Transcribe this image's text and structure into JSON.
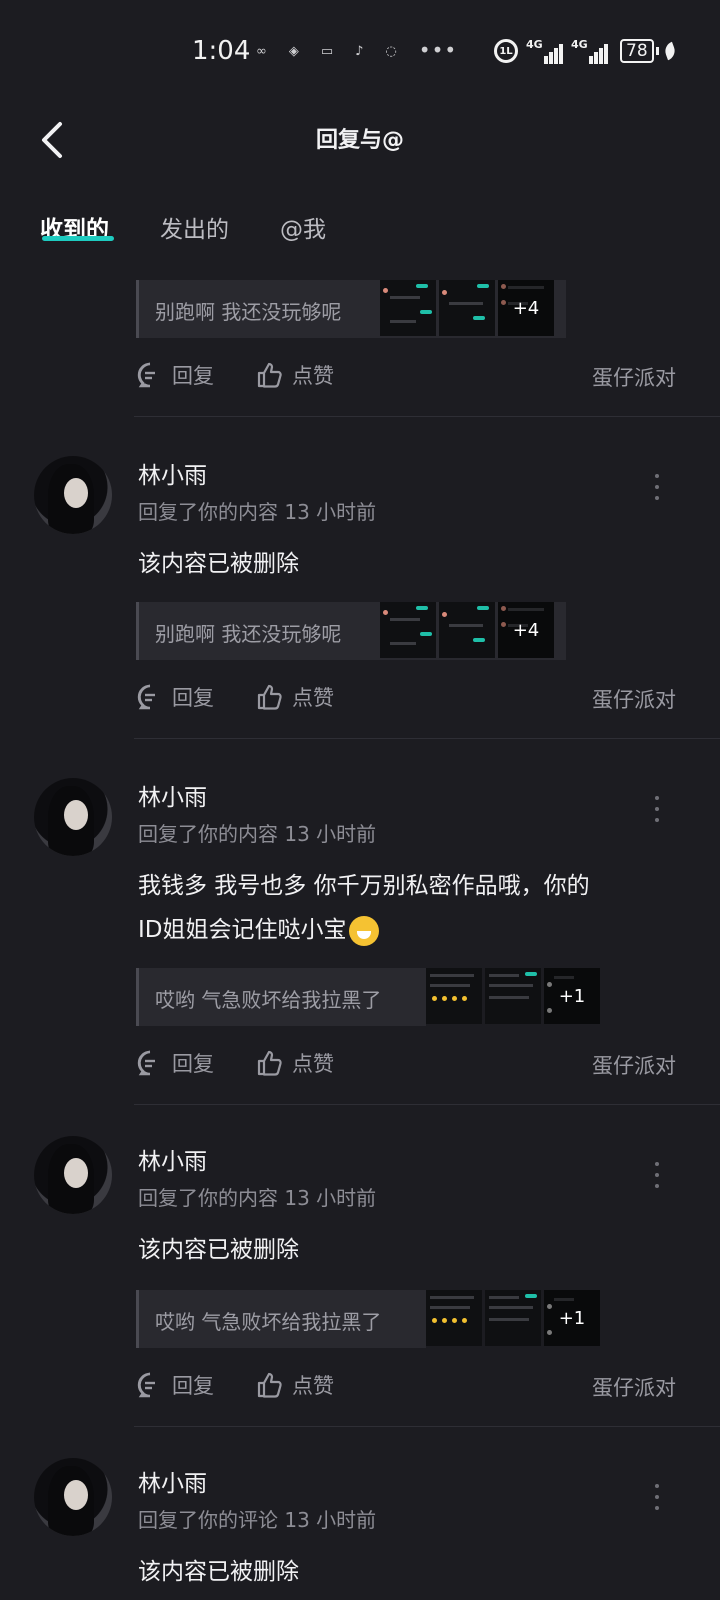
{
  "status_bar": {
    "time": "1:04",
    "hd_label": "1L",
    "network_1": "4G",
    "network_2": "4G",
    "battery": "78",
    "more": "•••"
  },
  "nav": {
    "title": "回复与@"
  },
  "tabs": [
    {
      "label": "收到的",
      "active": true
    },
    {
      "label": "发出的",
      "active": false
    },
    {
      "label": "@我",
      "active": false
    }
  ],
  "accent_color": "#1ecbc0",
  "actions": {
    "reply_label": "回复",
    "like_label": "点赞"
  },
  "items": [
    {
      "quote": "别跑啊 我还没玩够呢",
      "thumb_more": "+4",
      "source": "蛋仔派对"
    },
    {
      "username": "林小雨",
      "meta_action": "回复了你的内容",
      "meta_time": "13 小时前",
      "content": "该内容已被删除",
      "quote": "别跑啊 我还没玩够呢",
      "thumb_more": "+4",
      "source": "蛋仔派对"
    },
    {
      "username": "林小雨",
      "meta_action": "回复了你的内容",
      "meta_time": "13 小时前",
      "content_line1": "我钱多 我号也多 你千万别私密作品哦，你的",
      "content_line2": "ID姐姐会记住哒小宝",
      "content_emoji": "grinning-face-emoji",
      "quote": "哎哟 气急败坏给我拉黑了",
      "thumb_more": "+1",
      "source": "蛋仔派对"
    },
    {
      "username": "林小雨",
      "meta_action": "回复了你的内容",
      "meta_time": "13 小时前",
      "content": "该内容已被删除",
      "quote": "哎哟 气急败坏给我拉黑了",
      "thumb_more": "+1",
      "source": "蛋仔派对"
    },
    {
      "username": "林小雨",
      "meta_action": "回复了你的评论",
      "meta_time": "13 小时前",
      "content": "该内容已被删除"
    }
  ]
}
